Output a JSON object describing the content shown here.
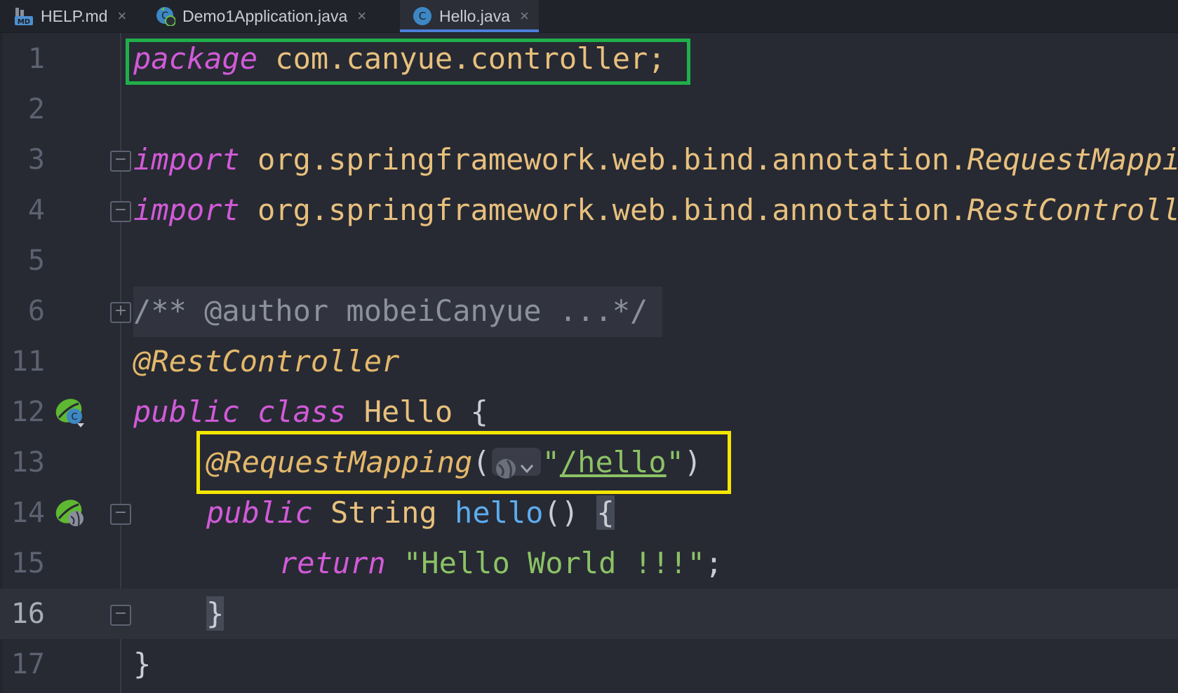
{
  "tabs": [
    {
      "label": "HELP.md",
      "icon": "markdown-file-icon",
      "active": false
    },
    {
      "label": "Demo1Application.java",
      "icon": "spring-app-class-icon",
      "active": false
    },
    {
      "label": "Hello.java",
      "icon": "java-class-icon",
      "active": true
    }
  ],
  "tab_close_glyph": "×",
  "line_numbers": [
    "1",
    "2",
    "3",
    "4",
    "5",
    "6",
    "11",
    "12",
    "13",
    "14",
    "15",
    "16",
    "17"
  ],
  "code": {
    "l1_kw": "package",
    "l1_rest": " com.canyue.controller;",
    "l3_kw": "import",
    "l3_rest": " org.springframework.web.bind.annotation.",
    "l3_cls": "RequestMapping;",
    "l4_kw": "import",
    "l4_rest": " org.springframework.web.bind.annotation.",
    "l4_cls": "RestController;",
    "l6_comment": "/** @author mobeiCanyue ...*/",
    "l11_ann": "@RestController",
    "l12_kw1": "public",
    "l12_kw2": "class",
    "l12_name": "Hello",
    "l12_brace": "{",
    "l13_ann": "@RequestMapping",
    "l13_open": "(",
    "l13_quote1": "\"",
    "l13_path": "/hello",
    "l13_quote2": "\"",
    "l13_close": ")",
    "l14_kw": "public",
    "l14_type": "String",
    "l14_fn": "hello",
    "l14_parens": "()",
    "l14_brace": "{",
    "l15_kw": "return",
    "l15_str": "\"Hello World !!!\"",
    "l15_semi": ";",
    "l16_brace": "}",
    "l17_brace": "}"
  },
  "colors": {
    "highlight_green": "#1fb04a",
    "highlight_yellow": "#f5e600",
    "keyword": "#d25ad8",
    "string": "#8cc265",
    "annotation": "#e4b86a",
    "function": "#5cacf0"
  },
  "gutter_icons": [
    "spring-bean-class-icon",
    "spring-web-endpoint-icon"
  ]
}
